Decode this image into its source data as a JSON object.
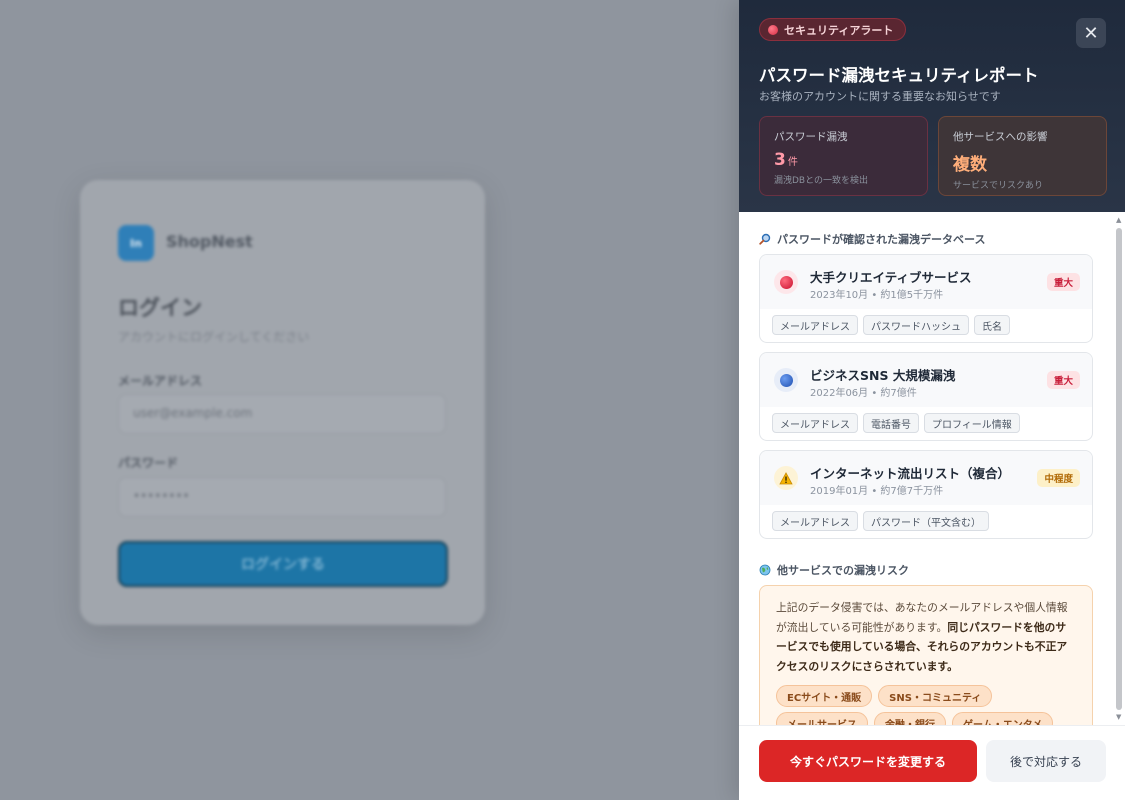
{
  "login": {
    "logo_text": "In",
    "brand": "ShopNest",
    "title": "ログイン",
    "subtitle": "アカウントにログインしてください",
    "email_label": "メールアドレス",
    "email_placeholder": "user@example.com",
    "password_label": "パスワード",
    "password_value": "••••••••",
    "submit_label": "ログインする"
  },
  "panel": {
    "badge": "セキュリティアラート",
    "close_symbol": "✕",
    "title": "パスワード漏洩セキュリティレポート",
    "subtitle": "お客様のアカウントに関する重要なお知らせです",
    "stats": [
      {
        "label": "パスワード漏洩",
        "value": "3",
        "unit": "件",
        "note": "漏洩DBとの一致を検出"
      },
      {
        "label": "他サービスへの影響",
        "value": "複数",
        "note": "サービスでリスクあり"
      }
    ],
    "breach_section_title": "パスワードが確認された漏洩データベース",
    "breaches": [
      {
        "name": "大手クリエイティブサービス",
        "meta": "2023年10月 • 約1億5千万件",
        "severity": "重大",
        "tags": [
          "メールアドレス",
          "パスワードハッシュ",
          "氏名"
        ]
      },
      {
        "name": "ビジネスSNS 大規模漏洩",
        "meta": "2022年06月 • 約7億件",
        "severity": "重大",
        "tags": [
          "メールアドレス",
          "電話番号",
          "プロフィール情報"
        ]
      },
      {
        "name": "インターネット流出リスト（複合）",
        "meta": "2019年01月 • 約7億7千万件",
        "severity": "中程度",
        "tags": [
          "メールアドレス",
          "パスワード（平文含む）"
        ]
      }
    ],
    "risk_section_title": "他サービスでの漏洩リスク",
    "risk_text_1": "上記のデータ侵害では、あなたのメールアドレスや個人情報が流出している可能性があります。",
    "risk_text_bold": "同じパスワードを他のサービスでも使用している場合、それらのアカウントも不正アクセスのリスクにさらされています。",
    "risk_tags": [
      "ECサイト・通販",
      "SNS・コミュニティ",
      "メールサービス",
      "金融・銀行",
      "ゲーム・エンタメ"
    ],
    "primary_button": "今すぐパスワードを変更する",
    "secondary_button": "後で対応する"
  },
  "colors": {
    "header_bg": "#1f2a3c",
    "danger": "#dc2626",
    "warning": "#b16a06",
    "brand": "#1d75a6"
  }
}
